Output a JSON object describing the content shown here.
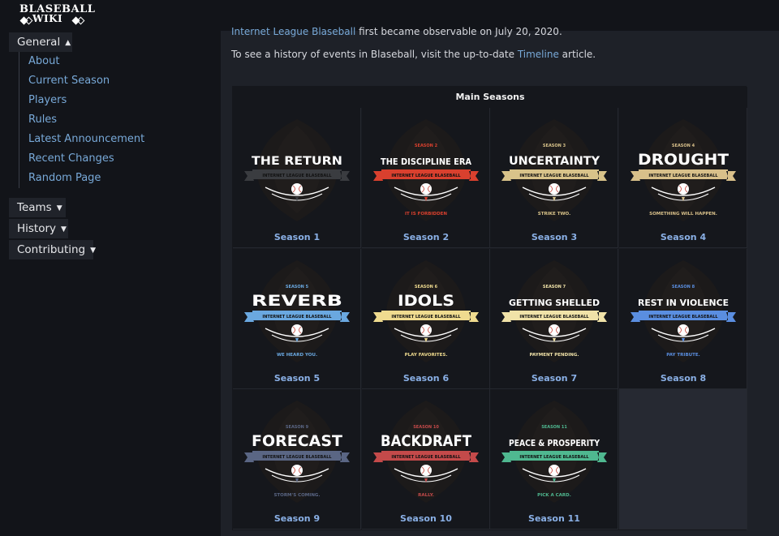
{
  "logo": {
    "line1": "BLASEBALL",
    "line2": "WIKI"
  },
  "nav": {
    "general": {
      "label": "General",
      "items": [
        "About",
        "Current Season",
        "Players",
        "Rules",
        "Latest Announcement",
        "Recent Changes",
        "Random Page"
      ]
    },
    "teams": "Teams",
    "history": "History",
    "contributing": "Contributing"
  },
  "intro": {
    "line1_link": "Internet League Blaseball",
    "line1_rest": " first became observable on July 20, 2020.",
    "line2_pre": "To see a history of events in Blaseball, visit the up-to-date ",
    "line2_link": "Timeline",
    "line2_post": " article."
  },
  "table": {
    "title": "Main Seasons",
    "seasons": [
      {
        "label": "Season 1",
        "logo_title": "THE RETURN",
        "number": "",
        "tagline": "",
        "ribbon_color": "#3a3c40",
        "banner": "INTERNET LEAGUE BLASEBALL"
      },
      {
        "label": "Season 2",
        "logo_title": "THE DISCIPLINE ERA",
        "number": "SEASON 2",
        "tagline": "IT IS FORBIDDEN",
        "ribbon_color": "#d9402e",
        "banner": "INTERNET LEAGUE BLASEBALL"
      },
      {
        "label": "Season 3",
        "logo_title": "UNCERTAINTY",
        "number": "SEASON 3",
        "tagline": "STRIKE TWO.",
        "ribbon_color": "#d8c38a",
        "banner": "INTERNET LEAGUE BLASEBALL"
      },
      {
        "label": "Season 4",
        "logo_title": "DROUGHT",
        "number": "SEASON 4",
        "tagline": "SOMETHING WILL HAPPEN.",
        "ribbon_color": "#d8c08a",
        "banner": "INTERNET LEAGUE BLASEBALL"
      },
      {
        "label": "Season 5",
        "logo_title": "REVERB",
        "number": "SEASON 5",
        "tagline": "WE HEARD YOU.",
        "ribbon_color": "#6aa8e0",
        "banner": "INTERNET LEAGUE BLASEBALL"
      },
      {
        "label": "Season 6",
        "logo_title": "IDOLS",
        "number": "SEASON 6",
        "tagline": "PLAY FAVORITES.",
        "ribbon_color": "#efdb8f",
        "banner": "INTERNET LEAGUE BLASEBALL"
      },
      {
        "label": "Season 7",
        "logo_title": "GETTING SHELLED",
        "number": "SEASON 7",
        "tagline": "PAYMENT PENDING.",
        "ribbon_color": "#f0e2a8",
        "banner": "INTERNET LEAGUE BLASEBALL"
      },
      {
        "label": "Season 8",
        "logo_title": "REST IN VIOLENCE",
        "number": "SEASON 8",
        "tagline": "PAY TRIBUTE.",
        "ribbon_color": "#5a8ee0",
        "banner": "INTERNET LEAGUE BLASEBALL"
      },
      {
        "label": "Season 9",
        "logo_title": "FORECAST",
        "number": "SEASON 9",
        "tagline": "STORM'S COMING.",
        "ribbon_color": "#5a6684",
        "banner": "INTERNET LEAGUE BLASEBALL"
      },
      {
        "label": "Season 10",
        "logo_title": "BACKDRAFT",
        "number": "SEASON 10",
        "tagline": "RALLY.",
        "ribbon_color": "#c44a4a",
        "banner": "INTERNET LEAGUE BLASEBALL"
      },
      {
        "label": "Season 11",
        "logo_title": "PEACE & PROSPERITY",
        "number": "SEASON 11",
        "tagline": "PICK A CARD.",
        "ribbon_color": "#4fb890",
        "banner": "INTERNET LEAGUE BLASEBALL"
      }
    ]
  },
  "colors": {
    "link": "#78a9d8",
    "caption": "#8ab0e6"
  }
}
